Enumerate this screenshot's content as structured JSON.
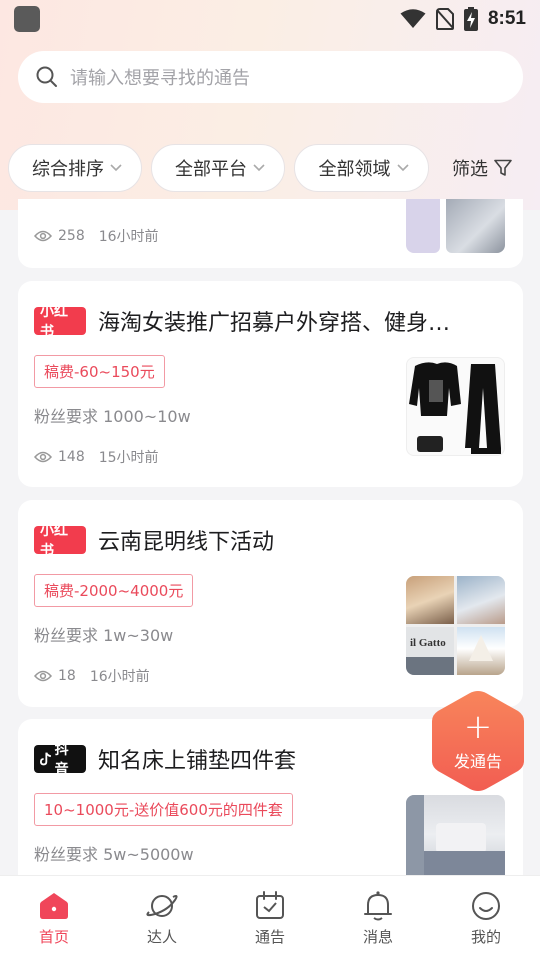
{
  "status_bar": {
    "time": "8:51",
    "icons": [
      "wifi-icon",
      "no-sim-icon",
      "battery-charging-icon"
    ]
  },
  "search": {
    "placeholder": "请输入想要寻找的通告",
    "icon": "search-icon"
  },
  "filters": {
    "sort": "综合排序",
    "platform": "全部平台",
    "domain": "全部领域",
    "filter_label": "筛选"
  },
  "cards": [
    {
      "views": "258",
      "time": "16小时前"
    },
    {
      "platform": "小红书",
      "title": "海淘女装推广招募户外穿搭、健身…",
      "fee": "稿费-60~150元",
      "fans": "粉丝要求 1000~10w",
      "views": "148",
      "time": "15小时前"
    },
    {
      "platform": "小红书",
      "title": "云南昆明线下活动",
      "fee": "稿费-2000~4000元",
      "fans": "粉丝要求 1w~30w",
      "views": "18",
      "time": "16小时前",
      "thumb_text": "il Gatto"
    },
    {
      "platform": "抖音",
      "title": "知名床上铺垫四件套",
      "fee": "10~1000元-送价值600元的四件套",
      "fans": "粉丝要求 5w~5000w"
    }
  ],
  "fab": {
    "label": "发通告",
    "icon": "plus-icon"
  },
  "tabs": [
    {
      "label": "首页",
      "icon": "home-icon",
      "active": true
    },
    {
      "label": "达人",
      "icon": "planet-icon",
      "active": false
    },
    {
      "label": "通告",
      "icon": "calendar-check-icon",
      "active": false
    },
    {
      "label": "消息",
      "icon": "bell-icon",
      "active": false
    },
    {
      "label": "我的",
      "icon": "smile-icon",
      "active": false
    }
  ],
  "colors": {
    "accent": "#f0465a",
    "xhs_red": "#f23c4d",
    "fab_orange": "#f5694f"
  }
}
